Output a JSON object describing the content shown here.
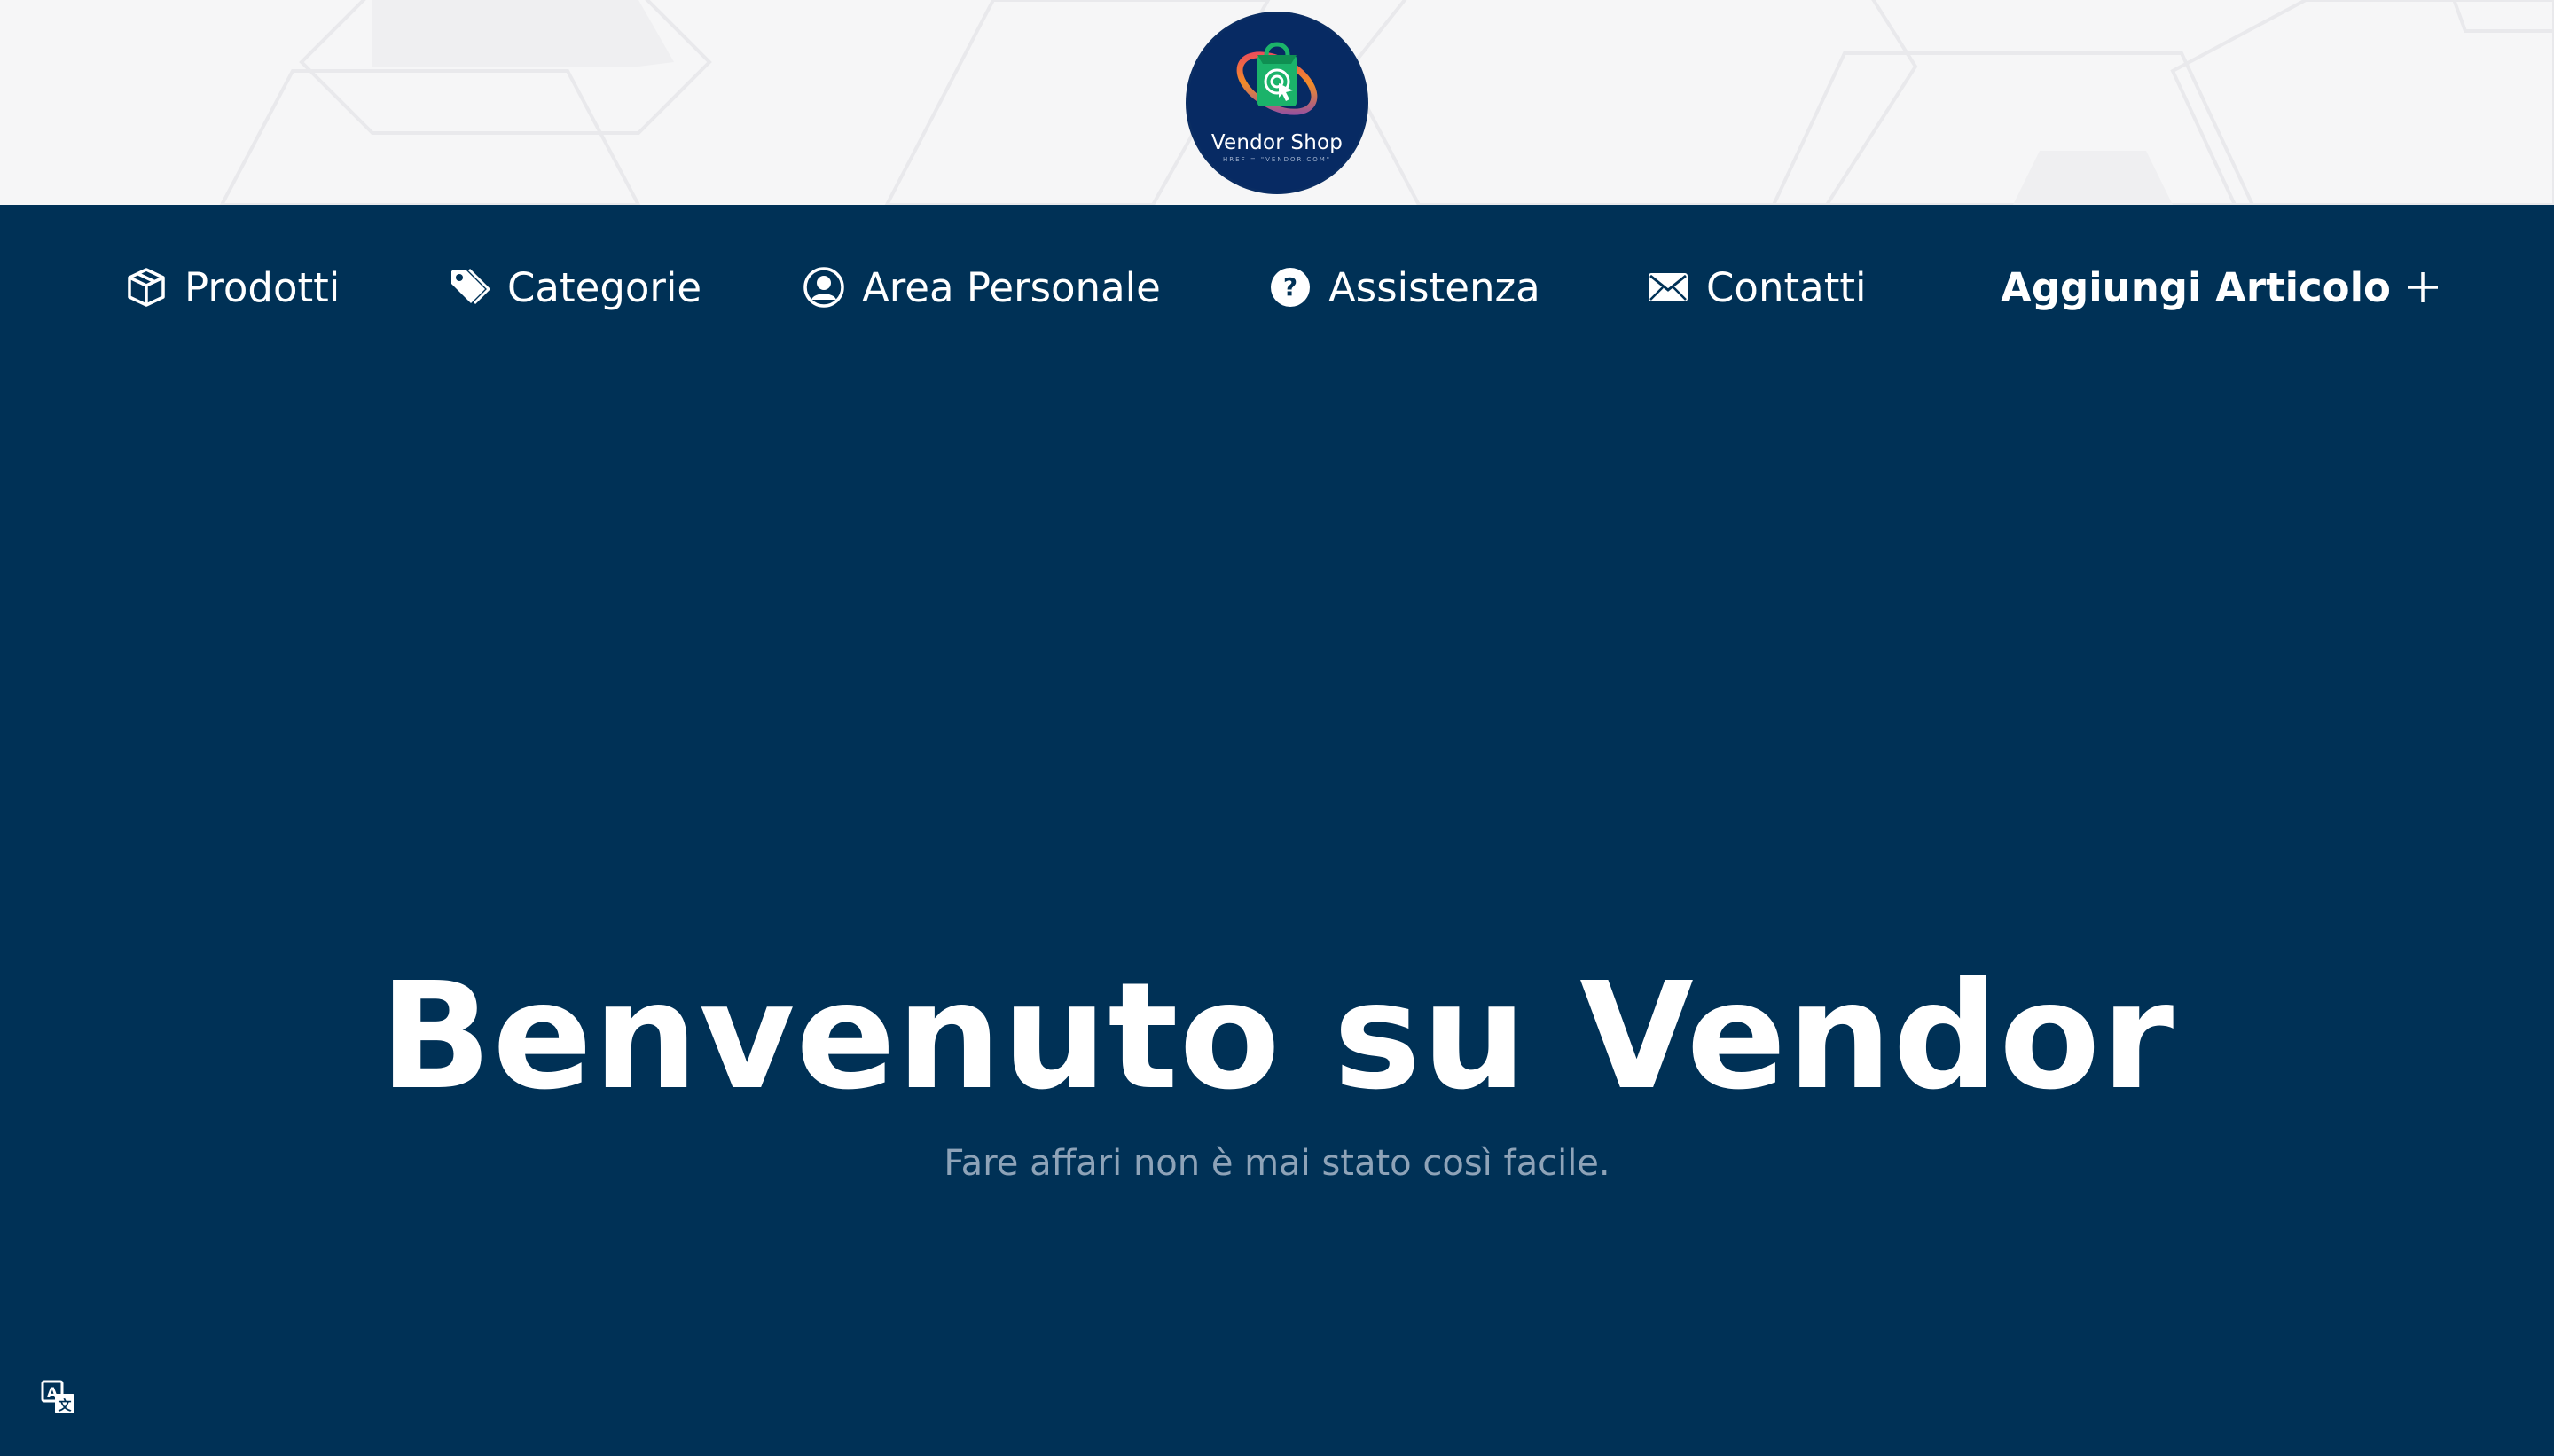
{
  "header": {
    "logo": {
      "title": "Vendor Shop",
      "subtitle": "HREF = \"VENDOR.COM\"",
      "icon": "shopping-bag-cursor-icon"
    }
  },
  "nav": {
    "items": [
      {
        "label": "Prodotti",
        "icon": "box-icon"
      },
      {
        "label": "Categorie",
        "icon": "tag-icon"
      },
      {
        "label": "Area Personale",
        "icon": "user-circle-icon"
      },
      {
        "label": "Assistenza",
        "icon": "question-circle-icon"
      },
      {
        "label": "Contatti",
        "icon": "envelope-icon"
      }
    ],
    "add_item": {
      "label": "Aggiungi Articolo",
      "icon": "plus-icon"
    }
  },
  "hero": {
    "title": "Benvenuto su Vendor",
    "subtitle": "Fare affari non è mai stato così facile."
  },
  "translate": {
    "icon": "translate-icon"
  },
  "colors": {
    "background": "#003156",
    "header_band": "#f6f6f7",
    "logo_bg": "#072a63",
    "text": "#ffffff",
    "subtitle": "#8ea3b8"
  }
}
